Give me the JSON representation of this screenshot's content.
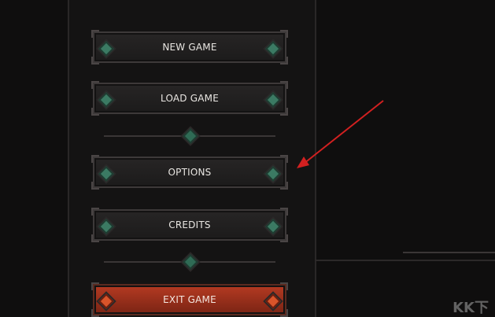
{
  "menu": {
    "new_game": "NEW GAME",
    "load_game": "LOAD GAME",
    "options": "OPTIONS",
    "credits": "CREDITS",
    "exit_game": "EXIT GAME"
  },
  "watermark": "KK下",
  "colors": {
    "background": "#0f0e0e",
    "panel": "#141313",
    "gem": "#3b7a63",
    "exit_button": "#b53a22",
    "annotation_arrow": "#d22020"
  },
  "icons": [
    "gem-icon",
    "divider-gem-icon",
    "red-arrow-annotation"
  ]
}
